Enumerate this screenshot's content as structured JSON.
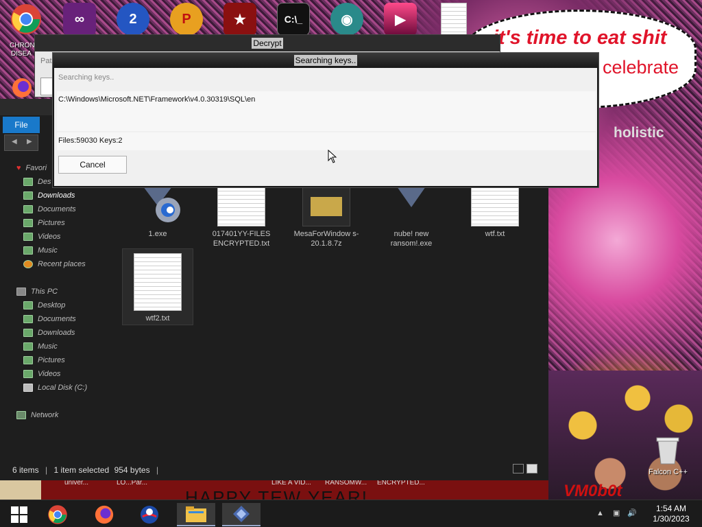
{
  "desktop": {
    "chrome_label_1": "CHRON",
    "chrome_label_2": "DISEA"
  },
  "wallpaper": {
    "speech_line1": "it's time to eat shit",
    "speech_line2": "celebrate",
    "holistic": "holistic",
    "banner_text": "HAPPY TEW YEAR!",
    "banner_tl1": "univer...",
    "banner_tl2": "LO...Par...",
    "banner_tl3": "LIKE A VID...",
    "banner_tl4": "RANSOMW...",
    "banner_tl5": "ENCRYPTED...",
    "vm_tag": "VM0b0t"
  },
  "decrypt_window": {
    "title": "Decrypt",
    "path_label": "Pat"
  },
  "search_dialog": {
    "title": "Searching keys..",
    "status": "Searching keys..",
    "current_path": "C:\\Windows\\Microsoft.NET\\Framework\\v4.0.30319\\SQL\\en",
    "counts": "Files:59030 Keys:2",
    "cancel_label": "Cancel"
  },
  "explorer": {
    "file_tab": "File",
    "nav": {
      "favorites": "Favori",
      "desktop_short": "Des",
      "downloads": "Downloads",
      "documents": "Documents",
      "pictures": "Pictures",
      "videos": "Videos",
      "music": "Music",
      "recent": "Recent places",
      "this_pc": "This PC",
      "pc_desktop": "Desktop",
      "pc_documents": "Documents",
      "pc_downloads": "Downloads",
      "pc_music": "Music",
      "pc_pictures": "Pictures",
      "pc_videos": "Videos",
      "local_disk": "Local Disk (C:)",
      "network": "Network"
    },
    "files": [
      {
        "name": "1.exe"
      },
      {
        "name": "017401YY-FILES ENCRYPTED.txt"
      },
      {
        "name": "MesaForWindow s-20.1.8.7z"
      },
      {
        "name": "nube! new ransom!.exe"
      },
      {
        "name": "wtf.txt"
      },
      {
        "name": "wtf2.txt"
      }
    ],
    "status": {
      "items": "6 items",
      "selected": "1 item selected",
      "size": "954 bytes"
    }
  },
  "recycle_bin": {
    "label": "Falcon C++"
  },
  "taskbar": {
    "time": "1:54 AM",
    "date": "1/30/2023"
  }
}
